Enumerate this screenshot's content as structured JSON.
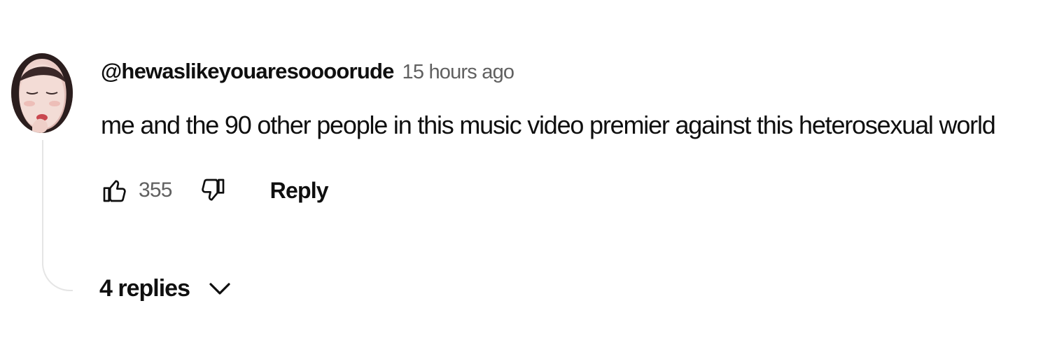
{
  "comment": {
    "author": "@hewaslikeyouaresoooorude",
    "timestamp": "15 hours ago",
    "text": "me and the 90 other people in this music video premier against this heterosexual world",
    "avatar_icon": "profile-photo",
    "like_icon": "thumbs-up-icon",
    "like_count": "355",
    "dislike_icon": "thumbs-down-icon",
    "reply_label": "Reply",
    "replies_label": "4 replies",
    "replies_icon": "chevron-down-icon"
  },
  "colors": {
    "primary_text": "#0f0f0f",
    "secondary_text": "#606060",
    "thread_line": "#e5e5e5",
    "background": "#ffffff"
  }
}
